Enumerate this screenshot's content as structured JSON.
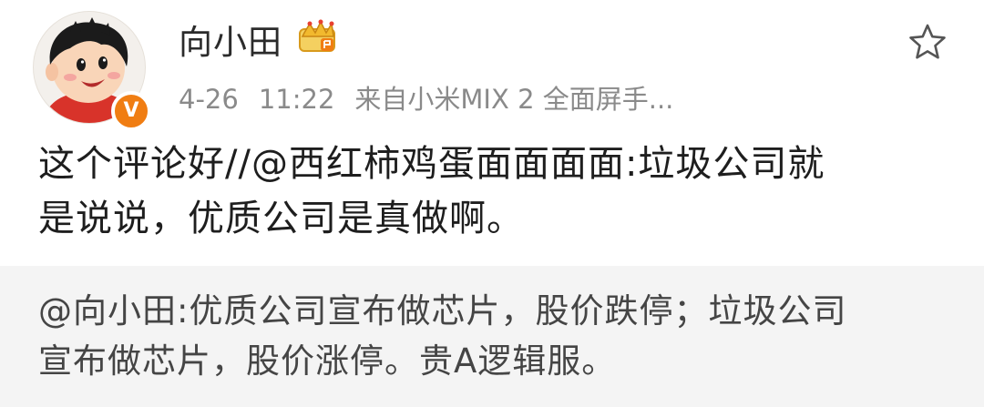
{
  "post": {
    "username": "向小田",
    "date": "4-26",
    "time": "11:22",
    "source": "来自小米MIX 2 全面屏手...",
    "content_line1": "这个评论好//@西红柿鸡蛋面面面面:垃圾公司就",
    "content_line2": "是说说，优质公司是真做啊。",
    "icons": {
      "avatar": "cartoon-boy-avatar",
      "verified": "verified-v-badge",
      "vip": "crown-icon",
      "favorite": "star-icon"
    },
    "colors": {
      "verified_badge": "#f07d12",
      "retweet_bg": "#f4f4f4",
      "meta_text": "#8a8a8a"
    }
  },
  "retweet": {
    "line1": "@向小田:优质公司宣布做芯片，股价跌停；垃圾公司",
    "line2": "宣布做芯片，股价涨停。贵A逻辑服。"
  },
  "badge_letter": "V"
}
